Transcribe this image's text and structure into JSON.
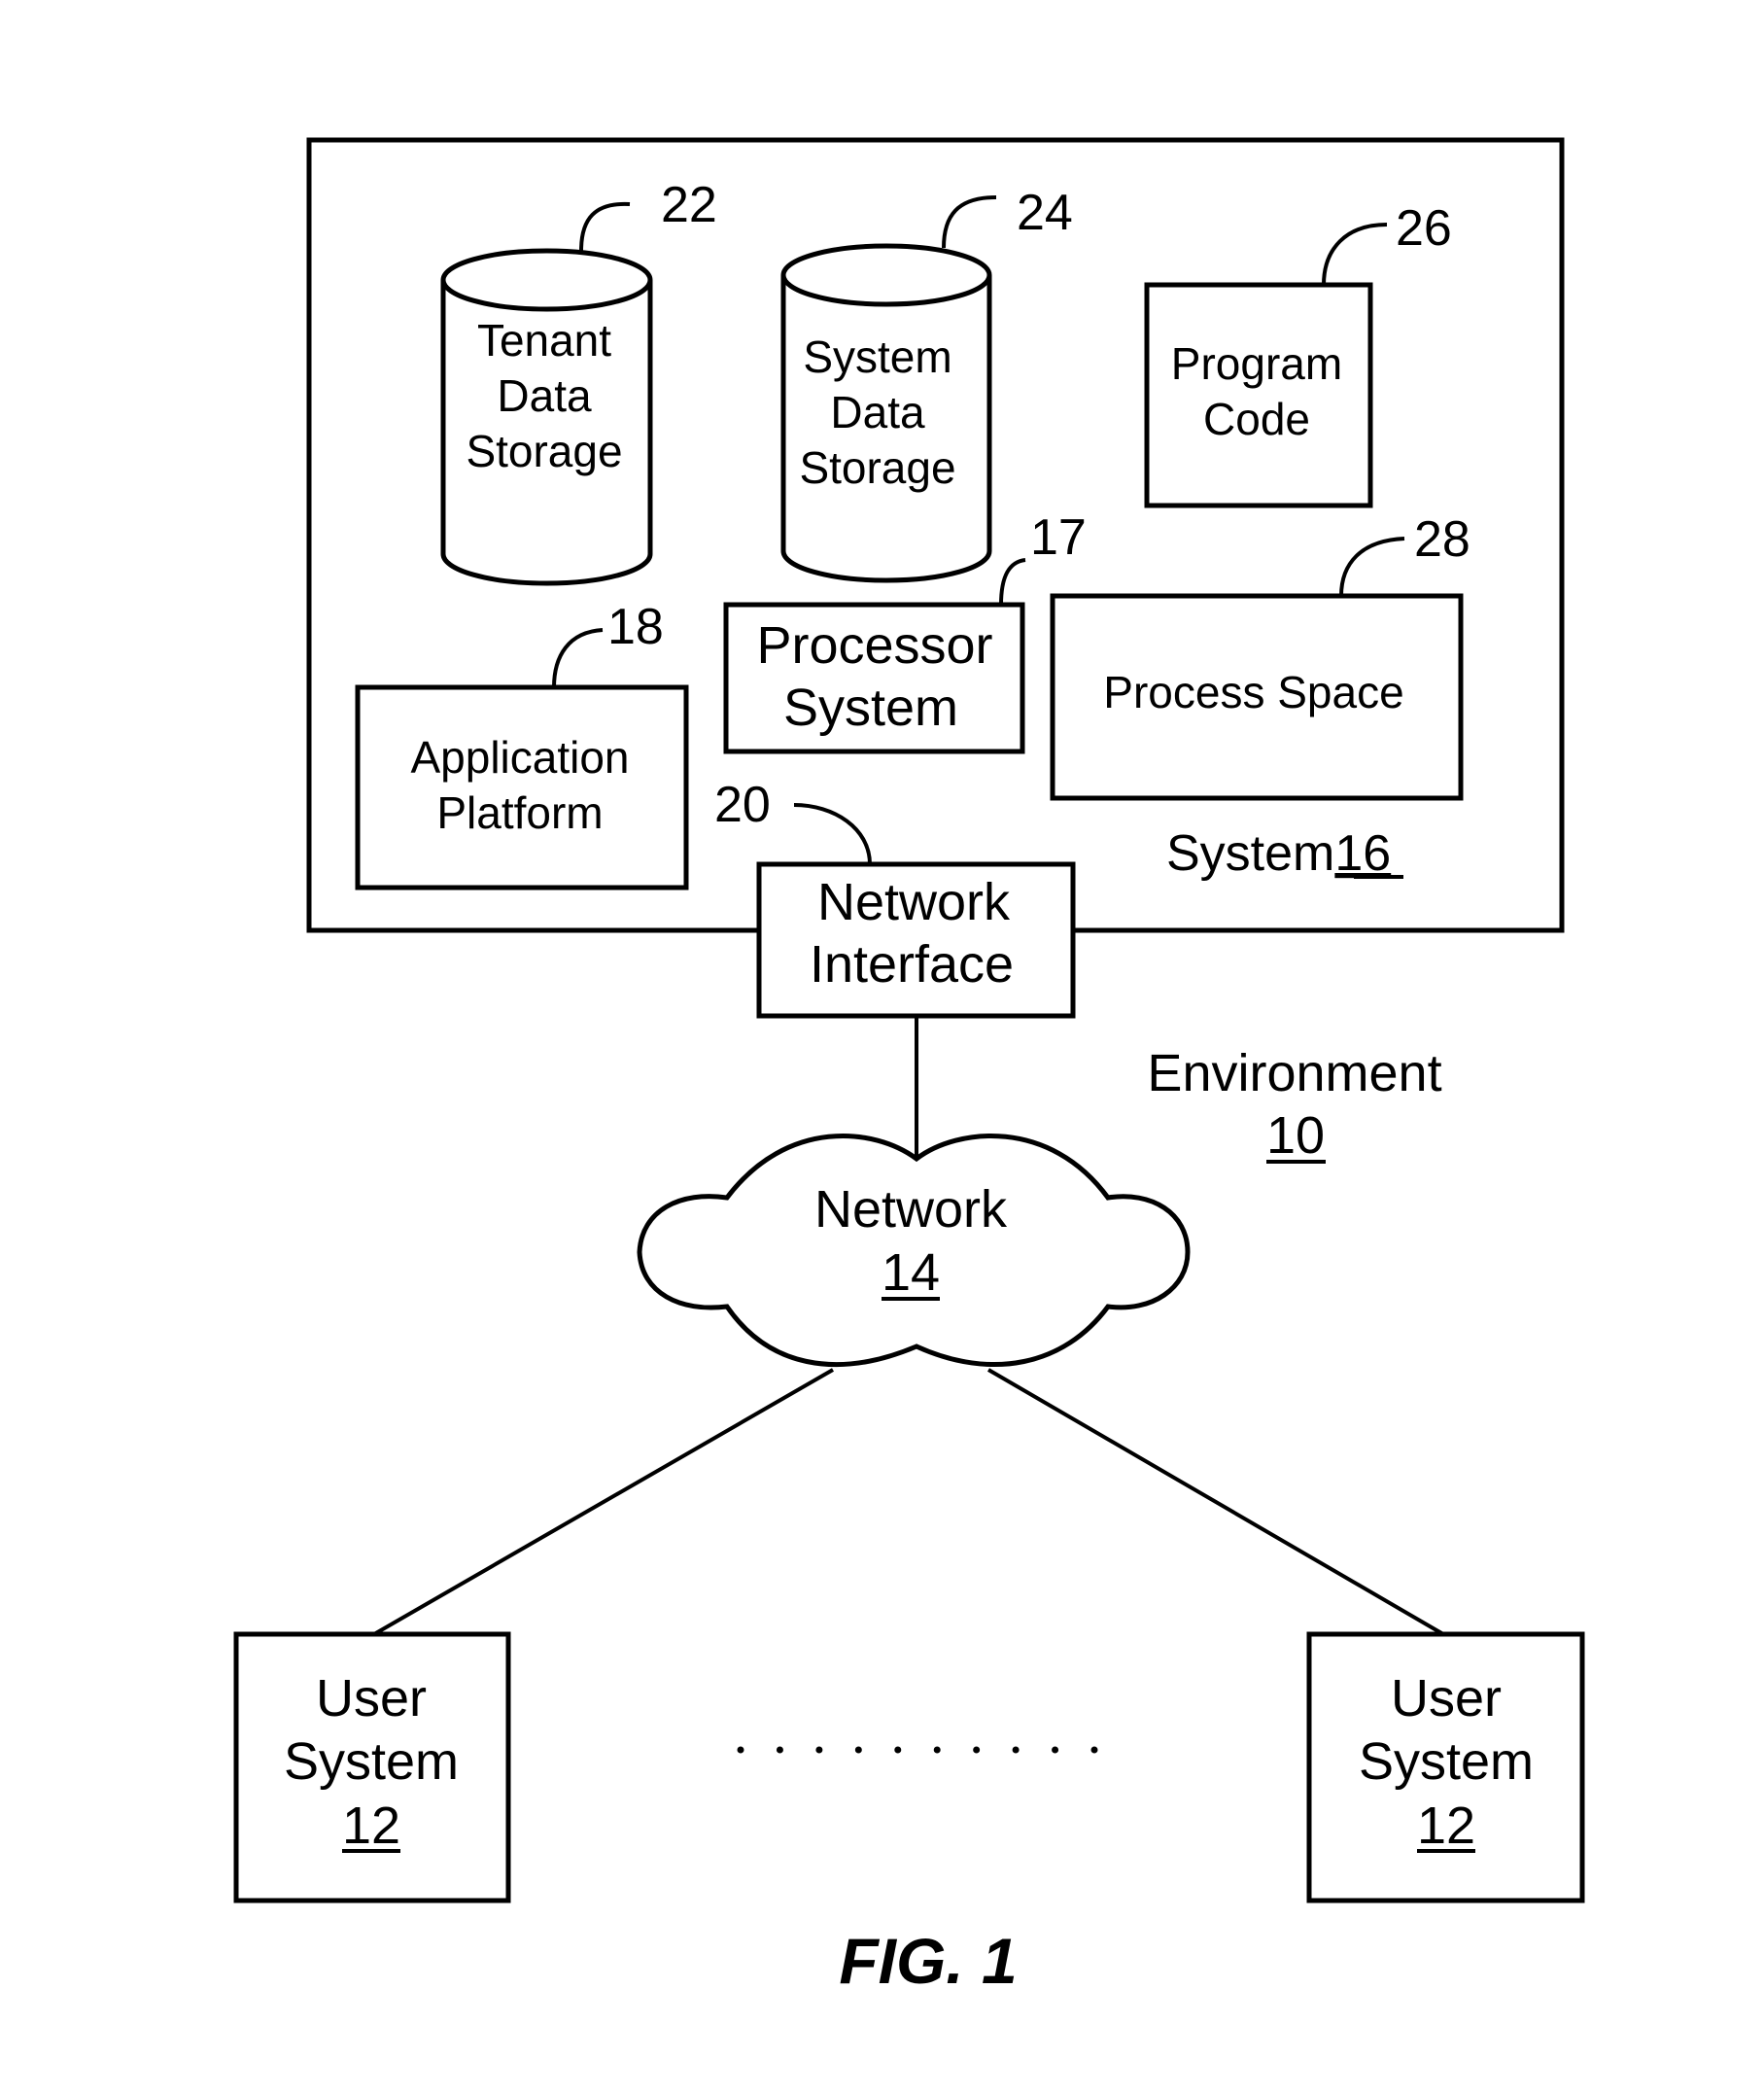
{
  "figure": {
    "caption": "FIG. 1",
    "environment": {
      "label": "Environment",
      "ref": "10"
    },
    "system": {
      "label": "System",
      "ref": "16"
    },
    "components": {
      "tenant_storage": {
        "lines": [
          "Tenant",
          "Data",
          "Storage"
        ],
        "ref": "22",
        "shape": "cylinder"
      },
      "system_storage": {
        "lines": [
          "System",
          "Data",
          "Storage"
        ],
        "ref": "24",
        "shape": "cylinder"
      },
      "program_code": {
        "lines": [
          "Program",
          "Code"
        ],
        "ref": "26"
      },
      "processor_system": {
        "lines": [
          "Processor",
          "System"
        ],
        "ref": "17"
      },
      "process_space": {
        "lines": [
          "Process Space"
        ],
        "ref": "28"
      },
      "application_platform": {
        "lines": [
          "Application",
          "Platform"
        ],
        "ref": "18"
      },
      "network_interface": {
        "lines": [
          "Network",
          "Interface"
        ],
        "ref": "20"
      }
    },
    "network": {
      "label": "Network",
      "ref": "14",
      "shape": "cloud"
    },
    "user_systems": [
      {
        "lines": [
          "User",
          "System"
        ],
        "ref": "12"
      },
      {
        "lines": [
          "User",
          "System"
        ],
        "ref": "12"
      }
    ],
    "ellipsis_dot_count": 10
  }
}
